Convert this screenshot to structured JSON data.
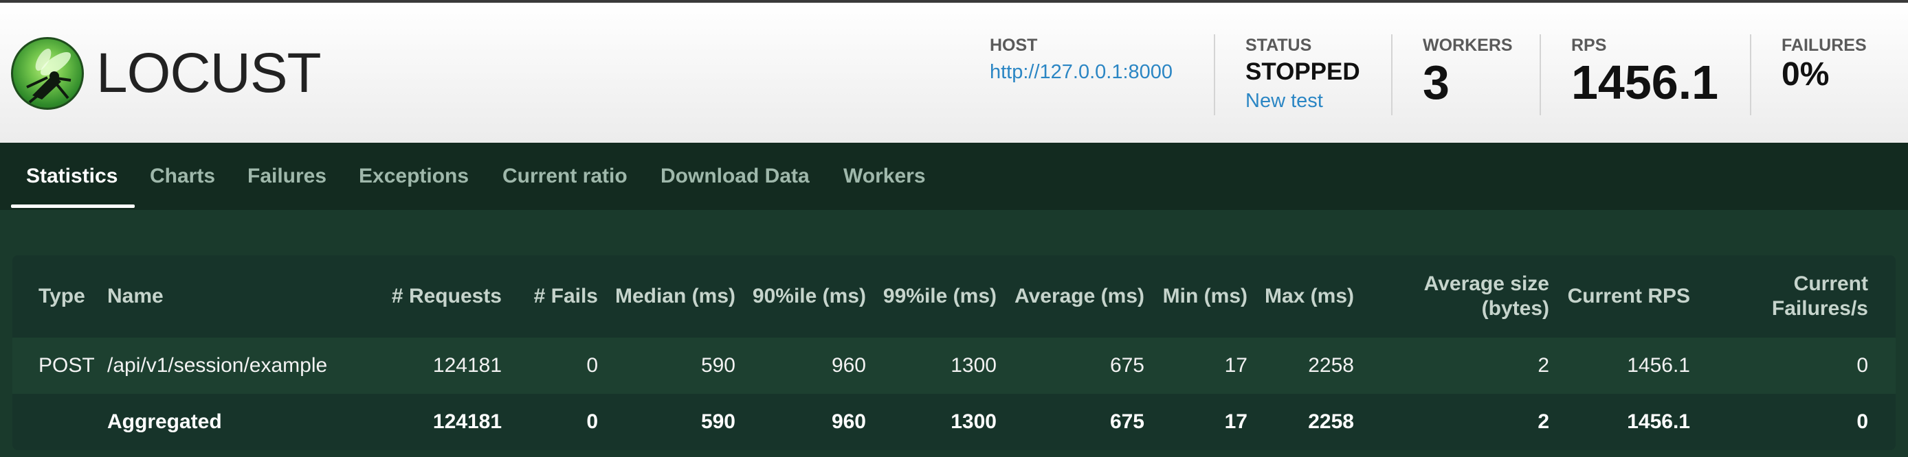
{
  "brand": {
    "name": "LOCUST"
  },
  "header": {
    "host": {
      "label": "HOST",
      "value": "http://127.0.0.1:8000"
    },
    "status": {
      "label": "STATUS",
      "value": "STOPPED",
      "action": "New test"
    },
    "workers": {
      "label": "WORKERS",
      "value": "3"
    },
    "rps": {
      "label": "RPS",
      "value": "1456.1"
    },
    "failures": {
      "label": "FAILURES",
      "value": "0%"
    }
  },
  "tabs": [
    "Statistics",
    "Charts",
    "Failures",
    "Exceptions",
    "Current ratio",
    "Download Data",
    "Workers"
  ],
  "active_tab": "Statistics",
  "table": {
    "headers": [
      "Type",
      "Name",
      "# Requests",
      "# Fails",
      "Median (ms)",
      "90%ile (ms)",
      "99%ile (ms)",
      "Average (ms)",
      "Min (ms)",
      "Max (ms)",
      "Average size (bytes)",
      "Current RPS",
      "Current Failures/s"
    ],
    "rows": [
      [
        "POST",
        "/api/v1/session/example",
        "124181",
        "0",
        "590",
        "960",
        "1300",
        "675",
        "17",
        "2258",
        "2",
        "1456.1",
        "0"
      ],
      [
        "",
        "Aggregated",
        "124181",
        "0",
        "590",
        "960",
        "1300",
        "675",
        "17",
        "2258",
        "2",
        "1456.1",
        "0"
      ]
    ]
  },
  "colors": {
    "accent": "#2b86c4",
    "tab_bg": "#132b20",
    "table_bg": "#17342a"
  }
}
